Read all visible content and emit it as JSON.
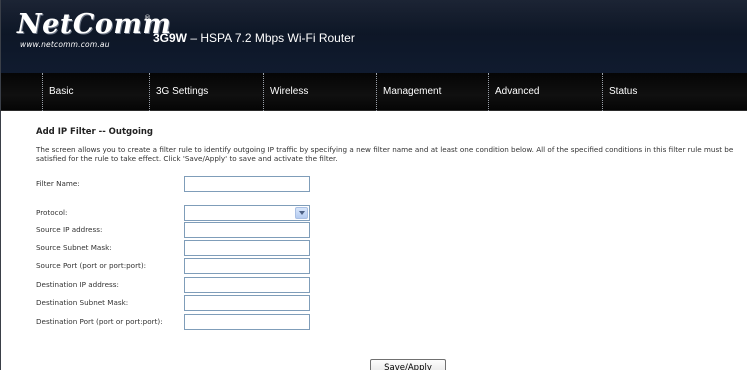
{
  "header": {
    "logo_text": "NetComm",
    "logo_reg": "®",
    "logo_url": "www.netcomm.com.au",
    "product_model": "3G9W",
    "product_desc": " – HSPA 7.2 Mbps Wi-Fi Router"
  },
  "nav": {
    "items": [
      {
        "label": "Basic"
      },
      {
        "label": "3G Settings"
      },
      {
        "label": "Wireless"
      },
      {
        "label": "Management"
      },
      {
        "label": "Advanced"
      },
      {
        "label": "Status"
      }
    ]
  },
  "page": {
    "title": "Add IP Filter -- Outgoing",
    "description": "The screen allows you to create a filter rule to identify outgoing IP traffic by specifying a new filter name and at least one condition below. All of the specified conditions in this filter rule must be satisfied for the rule to take effect. Click 'Save/Apply' to save and activate the filter."
  },
  "form": {
    "filter_name": {
      "label": "Filter Name:",
      "value": ""
    },
    "protocol": {
      "label": "Protocol:",
      "value": ""
    },
    "source_ip": {
      "label": "Source IP address:",
      "value": ""
    },
    "source_mask": {
      "label": "Source Subnet Mask:",
      "value": ""
    },
    "source_port": {
      "label": "Source Port (port or port:port):",
      "value": ""
    },
    "dest_ip": {
      "label": "Destination IP address:",
      "value": ""
    },
    "dest_mask": {
      "label": "Destination Subnet Mask:",
      "value": ""
    },
    "dest_port": {
      "label": "Destination Port (port or port:port):",
      "value": ""
    }
  },
  "actions": {
    "save_label": "Save/Apply"
  }
}
